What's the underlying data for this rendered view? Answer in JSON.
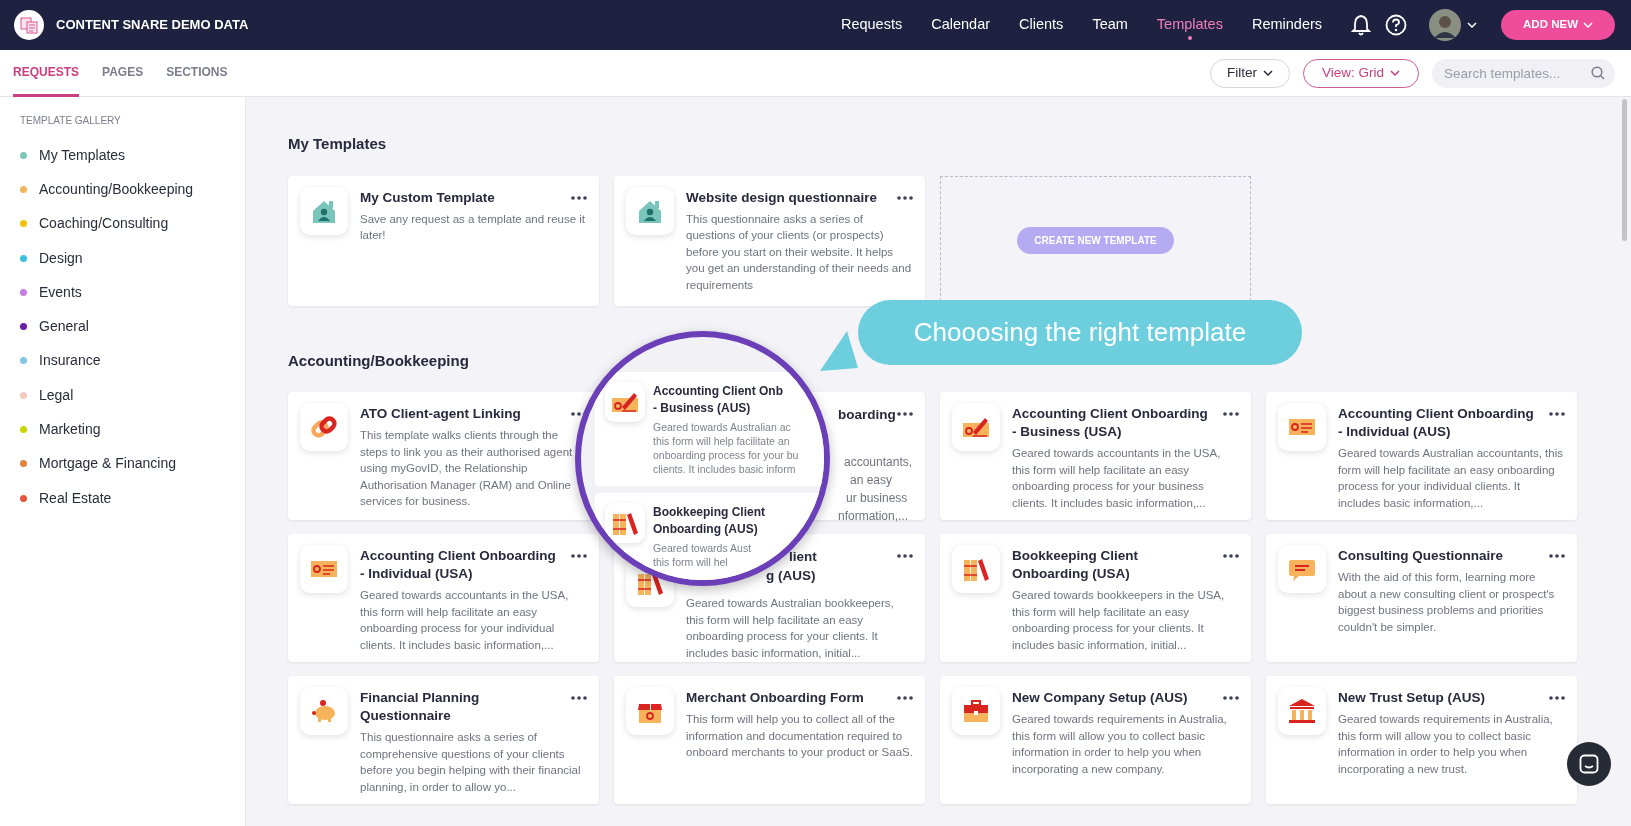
{
  "app": {
    "title": "CONTENT SNARE DEMO DATA"
  },
  "nav": [
    {
      "label": "Requests",
      "selected": false
    },
    {
      "label": "Calendar",
      "selected": false
    },
    {
      "label": "Clients",
      "selected": false
    },
    {
      "label": "Team",
      "selected": false
    },
    {
      "label": "Templates",
      "selected": true
    },
    {
      "label": "Reminders",
      "selected": false
    }
  ],
  "add_button": "ADD NEW",
  "tabs": [
    {
      "label": "REQUESTS",
      "selected": true
    },
    {
      "label": "PAGES",
      "selected": false
    },
    {
      "label": "SECTIONS",
      "selected": false
    }
  ],
  "filter_button": "Filter",
  "view_button": "View: Grid",
  "search": {
    "placeholder": "Search templates..."
  },
  "sidebar": {
    "heading": "TEMPLATE GALLERY",
    "items": [
      {
        "label": "My Templates",
        "color": "#7cc6be"
      },
      {
        "label": "Accounting/Bookkeeping",
        "color": "#f3b35f"
      },
      {
        "label": "Coaching/Consulting",
        "color": "#f5c10a"
      },
      {
        "label": "Design",
        "color": "#3dc1e2"
      },
      {
        "label": "Events",
        "color": "#c77de2"
      },
      {
        "label": "General",
        "color": "#6a1ea8"
      },
      {
        "label": "Insurance",
        "color": "#82c6e6"
      },
      {
        "label": "Legal",
        "color": "#f5cbc0"
      },
      {
        "label": "Marketing",
        "color": "#cad500"
      },
      {
        "label": "Mortgage & Financing",
        "color": "#e2843c"
      },
      {
        "label": "Real Estate",
        "color": "#e2553b"
      }
    ]
  },
  "sections": [
    {
      "title": "My Templates",
      "create_button": "CREATE NEW TEMPLATE",
      "cards": [
        {
          "kind": "house",
          "title": "My Custom Template",
          "description": "Save any request as a template and reuse it later!"
        },
        {
          "kind": "house",
          "title": "Website design questionnaire",
          "description": "This questionnaire asks a series of questions of your clients (or prospects) before you start on their website. It helps you get an understanding of their needs and requirements"
        }
      ]
    },
    {
      "title": "Accounting/Bookkeeping",
      "cards": [
        {
          "kind": "link",
          "title": "ATO Client-agent Linking",
          "description": "This template walks clients through the steps to link you as their authorised agent using myGovID, the Relationship Authorisation Manager (RAM) and Online services for business."
        },
        {
          "under_magnifier": true,
          "title_lines": [
            "boarding"
          ],
          "description_lines": [
            "accountants,",
            "an easy",
            "ur business",
            "nformation,..."
          ]
        },
        {
          "kind": "cheque",
          "title": "Accounting Client Onboarding - Business (USA)",
          "description": "Geared towards accountants in the USA, this form will help facilitate an easy onboarding process for your business clients. It includes basic information,..."
        },
        {
          "kind": "card",
          "title": "Accounting Client Onboarding - Individual (AUS)",
          "description": "Geared towards Australian accountants, this form will help facilitate an easy onboarding process for your individual clients. It includes basic information,..."
        },
        {
          "kind": "card",
          "title": "Accounting Client Onboarding - Individual (USA)",
          "description": "Geared towards accountants in the USA, this form will help facilitate an easy onboarding process for your individual clients. It includes basic information,..."
        },
        {
          "under_magnifier": true,
          "kind": "books",
          "title_lines": [
            "lient",
            "g (AUS)"
          ],
          "description": "Geared towards Australian bookkeepers, this form will help facilitate an easy onboarding process for your clients. It includes basic information, initial..."
        },
        {
          "kind": "books",
          "title": "Bookkeeping Client Onboarding (USA)",
          "description": "Geared towards bookkeepers in the USA, this form will help facilitate an easy onboarding process for your clients. It includes basic information, initial..."
        },
        {
          "kind": "chat",
          "title": "Consulting Questionnaire",
          "description": "With the aid of this form, learning more about a new consulting client or prospect's biggest business problems and priorities couldn't be simpler."
        },
        {
          "kind": "piggy",
          "title": "Financial Planning Questionnaire",
          "description": "This questionnaire asks a series of comprehensive questions of your clients before you begin helping with their financial planning, in order to allow yo..."
        },
        {
          "kind": "box",
          "title": "Merchant Onboarding Form",
          "description": "This form will help you to collect all of the information and documentation required to onboard merchants to your product or SaaS."
        },
        {
          "kind": "briefcase",
          "title": "New Company Setup (AUS)",
          "description": "Geared towards requirements in Australia, this form will allow you to collect basic information in order to help you when incorporating a new company."
        },
        {
          "kind": "bank",
          "title": "New Trust Setup (AUS)",
          "description": "Geared towards requirements in Australia, this form will allow you to collect basic information in order to help you when incorporating a new trust."
        }
      ]
    }
  ],
  "magnifier": {
    "cards": [
      {
        "kind": "cheque",
        "title_lines": [
          "Accounting Client Onb",
          "- Business (AUS)"
        ],
        "description_lines": [
          "Geared towards Australian ac",
          "this form will help facilitate an",
          "onboarding process for your bu",
          "clients. It includes basic inform"
        ]
      },
      {
        "kind": "books",
        "title_lines": [
          "Bookkeeping Client",
          "Onboarding (AUS)"
        ],
        "description_lines": [
          "Geared towards Aust",
          "this form will hel"
        ]
      }
    ]
  },
  "callout": {
    "text": "Chooosing the right template"
  }
}
